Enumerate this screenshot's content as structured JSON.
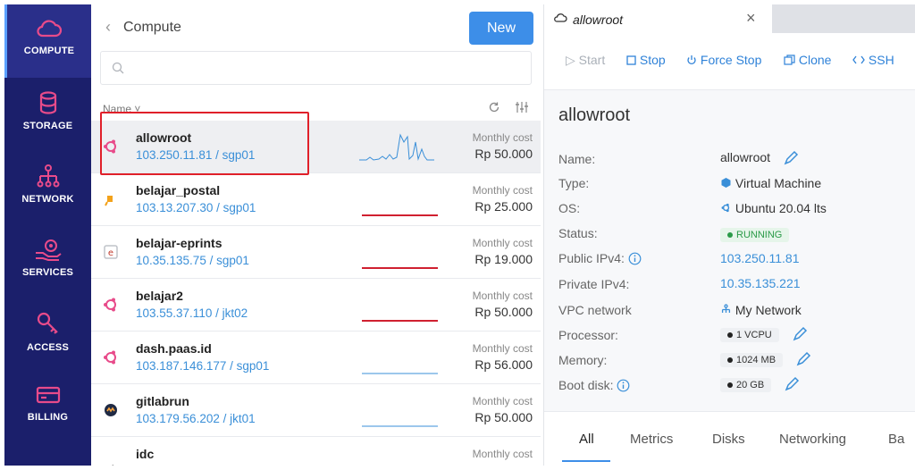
{
  "sidebar": {
    "items": [
      {
        "label": "COMPUTE",
        "icon": "cloud-icon"
      },
      {
        "label": "STORAGE",
        "icon": "database-icon"
      },
      {
        "label": "NETWORK",
        "icon": "network-icon"
      },
      {
        "label": "SERVICES",
        "icon": "services-icon"
      },
      {
        "label": "ACCESS",
        "icon": "key-icon"
      },
      {
        "label": "BILLING",
        "icon": "card-icon"
      }
    ],
    "active": "COMPUTE"
  },
  "list": {
    "breadcrumb": "Compute",
    "new_label": "New",
    "search_placeholder": "",
    "column_name": "Name ˅",
    "rows": [
      {
        "name": "allowroot",
        "address": "103.250.11.81 / sgp01",
        "cost_label": "Monthly cost",
        "cost": "Rp 50.000",
        "os": "ubuntu"
      },
      {
        "name": "belajar_postal",
        "address": "103.13.207.30 / sgp01",
        "cost_label": "Monthly cost",
        "cost": "Rp 25.000",
        "os": "postal"
      },
      {
        "name": "belajar-eprints",
        "address": "10.35.135.75 / sgp01",
        "cost_label": "Monthly cost",
        "cost": "Rp 19.000",
        "os": "eprints"
      },
      {
        "name": "belajar2",
        "address": "103.55.37.110 / jkt02",
        "cost_label": "Monthly cost",
        "cost": "Rp 50.000",
        "os": "ubuntu"
      },
      {
        "name": "dash.paas.id",
        "address": "103.187.146.177 / sgp01",
        "cost_label": "Monthly cost",
        "cost": "Rp 56.000",
        "os": "ubuntu"
      },
      {
        "name": "gitlabrun",
        "address": "103.179.56.202 / jkt01",
        "cost_label": "Monthly cost",
        "cost": "Rp 50.000",
        "os": "gitlab"
      },
      {
        "name": "idc",
        "address": "",
        "cost_label": "Monthly cost",
        "cost": "",
        "os": "other"
      }
    ]
  },
  "detail": {
    "tab_title": "allowroot",
    "actions": {
      "start": "▷ Start",
      "stop": "Stop",
      "force_stop": "Force Stop",
      "clone": "Clone",
      "ssh": "SSH"
    },
    "title": "allowroot",
    "labels": {
      "name": "Name:",
      "type": "Type:",
      "os": "OS:",
      "status": "Status:",
      "public_ip": "Public IPv4:",
      "private_ip": "Private IPv4:",
      "vpc": "VPC network",
      "processor": "Processor:",
      "memory": "Memory:",
      "boot_disk": "Boot disk:"
    },
    "values": {
      "name": "allowroot",
      "type": "Virtual Machine",
      "os": "Ubuntu 20.04 lts",
      "status": "RUNNING",
      "public_ip": "103.250.11.81",
      "private_ip": "10.35.135.221",
      "vpc": "My Network",
      "processor": "1 VCPU",
      "memory": "1024 MB",
      "boot_disk": "20 GB"
    },
    "bottom_tabs": [
      "All",
      "Metrics",
      "Disks",
      "Networking",
      "Ba"
    ]
  },
  "colors": {
    "sidebar_bg": "#1b1f6b",
    "accent": "#3d8ee8",
    "link": "#3a8fd8",
    "highlight": "#e0202a",
    "running": "#2a9a48"
  }
}
